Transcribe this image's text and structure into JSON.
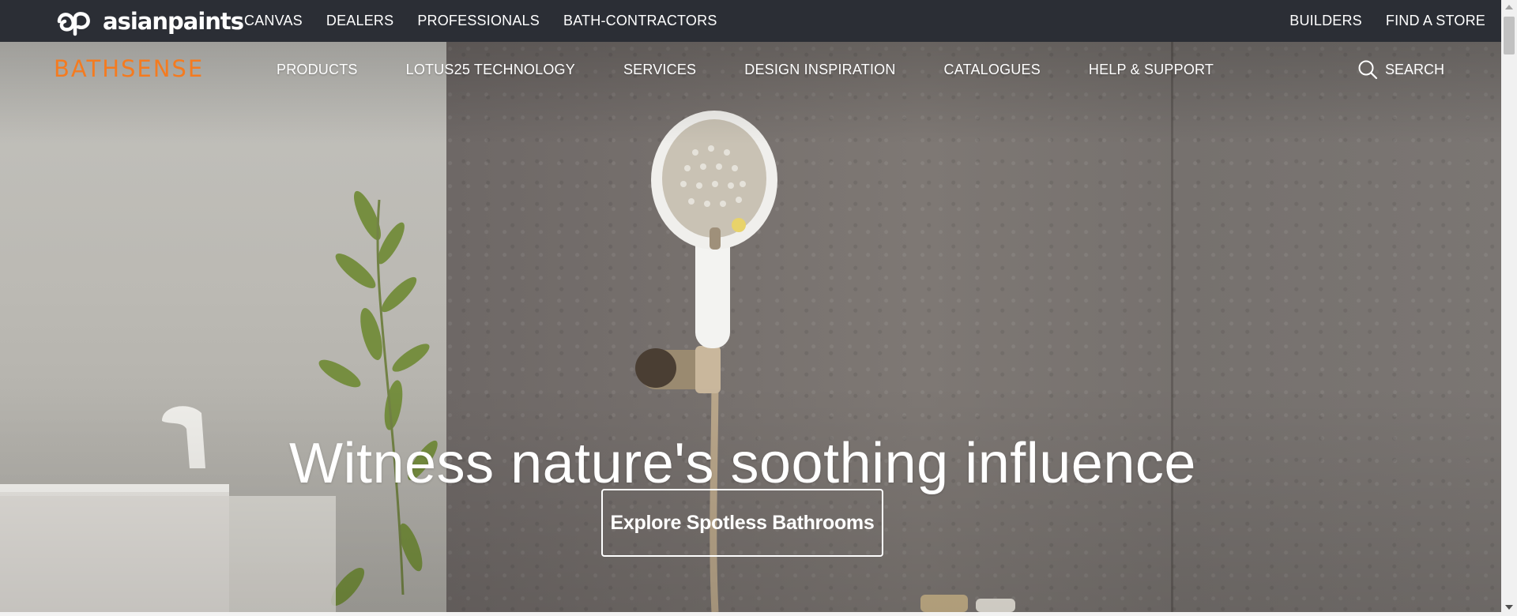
{
  "topbar": {
    "brand": {
      "name": "asianpaints",
      "icon": "asianpaints-logo-icon"
    },
    "left_links": [
      "CANVAS",
      "DEALERS",
      "PROFESSIONALS",
      "BATH-CONTRACTORS"
    ],
    "right_links": [
      "BUILDERS",
      "FIND A STORE"
    ]
  },
  "mainnav": {
    "logo": "BATHSENSE",
    "items": [
      "PRODUCTS",
      "LOTUS25 TECHNOLOGY",
      "SERVICES",
      "DESIGN INSPIRATION",
      "CATALOGUES",
      "HELP & SUPPORT"
    ],
    "search": {
      "label": "SEARCH",
      "icon": "search-icon"
    }
  },
  "hero": {
    "headline": "Witness nature's soothing influence",
    "cta": "Explore Spotless Bathrooms"
  },
  "colors": {
    "topbar_bg": "#2b2e35",
    "brand_orange": "#f47b20",
    "text_white": "#ffffff"
  }
}
